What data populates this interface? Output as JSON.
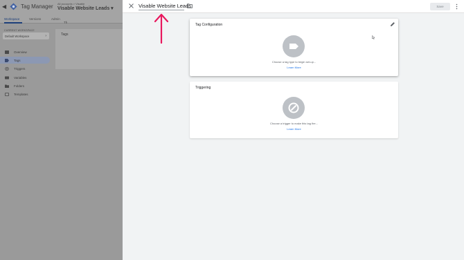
{
  "app": {
    "name": "Tag Manager",
    "breadcrumb": "All accounts > Visable",
    "container": "Visable Website Leads ▾",
    "tabs": [
      {
        "label": "Workspace"
      },
      {
        "label": "Versions"
      },
      {
        "label": "Admin"
      }
    ],
    "workspace_label": "CURRENT WORKSPACE",
    "workspace_value": "Default Workspace",
    "nav": [
      {
        "label": "Overview",
        "icon": "overview-icon"
      },
      {
        "label": "Tags",
        "icon": "tag-icon"
      },
      {
        "label": "Triggers",
        "icon": "trigger-icon"
      },
      {
        "label": "Variables",
        "icon": "variables-icon"
      },
      {
        "label": "Folders",
        "icon": "folder-icon"
      },
      {
        "label": "Templates",
        "icon": "templates-icon"
      }
    ],
    "content_title": "Tags",
    "content_fragment": "Th"
  },
  "panel": {
    "title": "Visable Website Leads",
    "save_label": "Save",
    "config": {
      "title": "Tag Configuration",
      "hint": "Choose a tag type to begin set-up...",
      "link": "Learn More"
    },
    "triggering": {
      "title": "Triggering",
      "hint": "Choose a trigger to make this tag fire...",
      "link": "Learn More"
    }
  },
  "colors": {
    "accent": "#1a73e8",
    "annotation_arrow": "#e8175d",
    "placeholder_circle": "#bdc1c6"
  }
}
